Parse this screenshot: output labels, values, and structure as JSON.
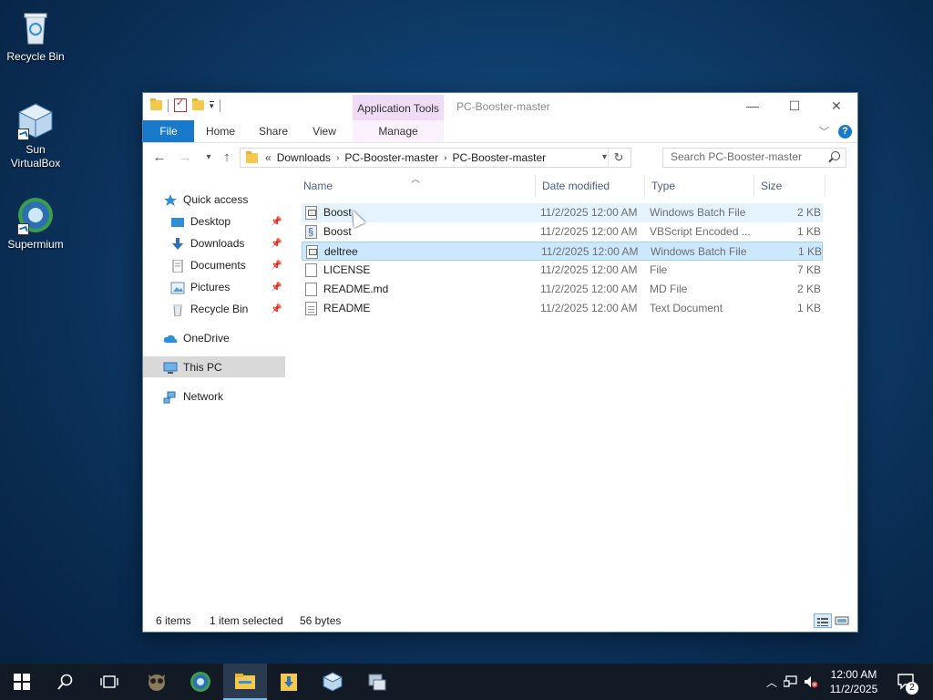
{
  "desktop": {
    "icons": [
      {
        "label": "Recycle Bin"
      },
      {
        "label": "Sun VirtualBox"
      },
      {
        "label": "Supermium"
      }
    ]
  },
  "window": {
    "title": "PC-Booster-master",
    "context_tab_header": "Application Tools",
    "ribbon_tabs": [
      "File",
      "Home",
      "Share",
      "View",
      "Manage"
    ],
    "address": {
      "overflow": "«",
      "crumbs": [
        "Downloads",
        "PC-Booster-master",
        "PC-Booster-master"
      ]
    },
    "search": {
      "placeholder": "Search PC-Booster-master"
    },
    "nav": {
      "quick_access": "Quick access",
      "pinned": [
        "Desktop",
        "Downloads",
        "Documents",
        "Pictures",
        "Recycle Bin"
      ],
      "onedrive": "OneDrive",
      "this_pc": "This PC",
      "network": "Network"
    },
    "columns": [
      "Name",
      "Date modified",
      "Type",
      "Size"
    ],
    "files": [
      {
        "name": "Boost",
        "date": "11/2/2025 12:00 AM",
        "type": "Windows Batch File",
        "size": "2 KB",
        "icon": "batch-file-icon"
      },
      {
        "name": "Boost",
        "date": "11/2/2025 12:00 AM",
        "type": "VBScript Encoded ...",
        "size": "1 KB",
        "icon": "vbscript-file-icon"
      },
      {
        "name": "deltree",
        "date": "11/2/2025 12:00 AM",
        "type": "Windows Batch File",
        "size": "1 KB",
        "icon": "batch-file-icon"
      },
      {
        "name": "LICENSE",
        "date": "11/2/2025 12:00 AM",
        "type": "File",
        "size": "7 KB",
        "icon": "blank-file-icon"
      },
      {
        "name": "README.md",
        "date": "11/2/2025 12:00 AM",
        "type": "MD File",
        "size": "2 KB",
        "icon": "blank-file-icon"
      },
      {
        "name": "README",
        "date": "11/2/2025 12:00 AM",
        "type": "Text Document",
        "size": "1 KB",
        "icon": "text-file-icon"
      }
    ],
    "status": {
      "count": "6 items",
      "selection": "1 item selected",
      "selection_size": "56 bytes"
    }
  },
  "taskbar": {
    "time": "12:00 AM",
    "date": "11/2/2025",
    "notification_count": "2"
  },
  "colors": {
    "accent": "#1979ca",
    "context_tab": "#f1dcf7",
    "selection": "#cce8ff",
    "taskbar": "#111a25"
  }
}
